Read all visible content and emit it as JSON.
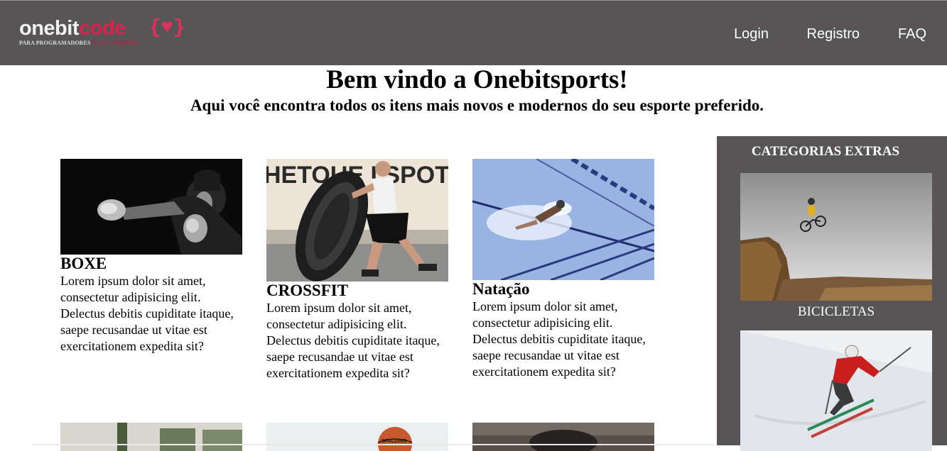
{
  "header": {
    "logo": {
      "part1": "onebit",
      "part2": "code",
      "brace": "{♥}",
      "tagline1": "PARA PROGRAMADORES",
      "tagline2": "NOVA CARREIRA"
    },
    "nav": [
      "Login",
      "Registro",
      "FAQ"
    ]
  },
  "welcome": {
    "title": "Bem vindo a Onebitsports!",
    "subtitle": "Aqui você encontra todos os itens mais novos e modernos do seu esporte preferido."
  },
  "cards": [
    {
      "title": "BOXE",
      "image": "boxer-photo",
      "text": "Lorem ipsum dolor sit amet, consectetur adipisicing elit. Delectus debitis cupiditate itaque, saepe recusandae ut vitae est exercitationem expedita sit?"
    },
    {
      "title": "CROSSFIT",
      "image": "tire-flip-photo",
      "text": "Lorem ipsum dolor sit amet, consectetur adipisicing elit. Delectus debitis cupiditate itaque, saepe recusandae ut vitae est exercitationem expedita sit?"
    },
    {
      "title": "Natação",
      "image": "swimmer-photo",
      "text": "Lorem ipsum dolor sit amet, consectetur adipisicing elit. Delectus debitis cupiditate itaque, saepe recusandae ut vitae est exercitationem expedita sit?"
    }
  ],
  "crossfit_sign": "HETOUE I SPOT",
  "basketball_text": "SPALDING",
  "sidebar": {
    "title": "CATEGORIAS EXTRAS",
    "items": [
      {
        "label": "BICICLETAS",
        "image": "mountain-bike-photo"
      },
      {
        "label": "",
        "image": "skier-photo"
      }
    ]
  }
}
